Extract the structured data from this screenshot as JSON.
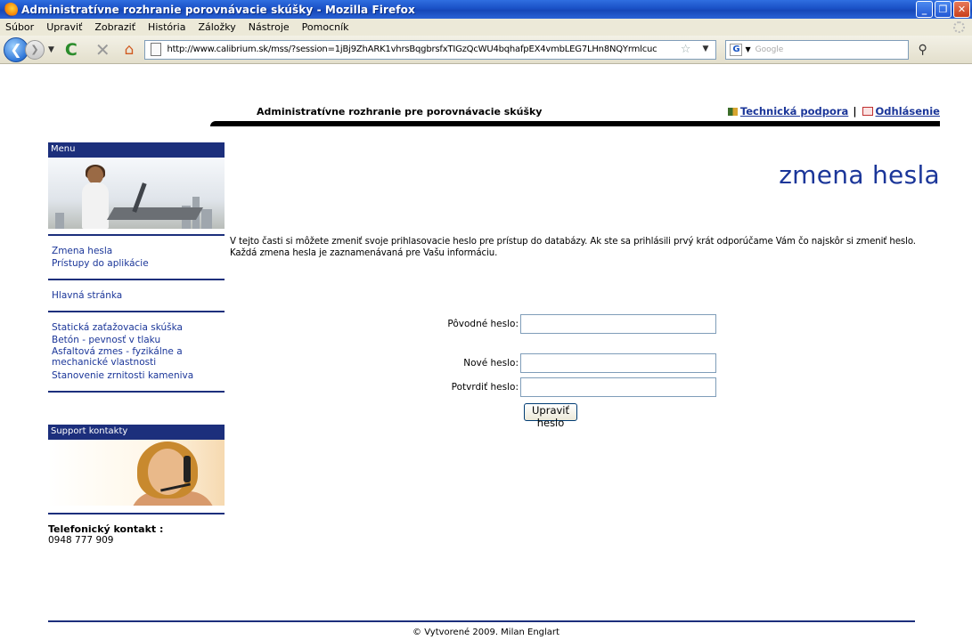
{
  "browser": {
    "window_title": "Administratívne rozhranie porovnávacie skúšky - Mozilla Firefox",
    "menu": [
      "Súbor",
      "Upraviť",
      "Zobraziť",
      "História",
      "Záložky",
      "Nástroje",
      "Pomocník"
    ],
    "url": "http://www.calibrium.sk/mss/?session=1jBj9ZhARK1vhrsBqgbrsfxTIGzQcWU4bqhafpEX4vmbLEG7LHn8NQYrmlcuc",
    "search_placeholder": "Google"
  },
  "header": {
    "title": "Administratívne rozhranie pre porovnávacie skúšky",
    "support_link": "Technická podpora",
    "separator": "|",
    "logout_link": "Odhlásenie"
  },
  "sidebar": {
    "menu_heading": "Menu",
    "groups": [
      [
        "Zmena hesla",
        "Prístupy do aplikácie"
      ],
      [
        "Hlavná stránka"
      ],
      [
        "Statická zaťažovacia skúška",
        "Betón - pevnosť v tlaku",
        "Asfaltová zmes - fyzikálne a mechanické vlastnosti",
        "Stanovenie zrnitosti kameniva"
      ]
    ],
    "support_heading": "Support kontakty",
    "phone_label": "Telefonický kontakt :",
    "phone_number": "0948 777 909"
  },
  "main": {
    "heading": "zmena hesla",
    "intro_line1": "V tejto časti si môžete zmeniť svoje prihlasovacie heslo pre prístup do databázy. Ak ste sa prihlásili prvý krát odporúčame Vám čo najskôr si zmeniť heslo.",
    "intro_line2": "Každá zmena hesla je zaznamenávaná pre Vašu informáciu.",
    "form": {
      "old_password_label": "Pôvodné heslo:",
      "old_password_value": "",
      "new_password_label": "Nové heslo:",
      "new_password_value": "",
      "confirm_password_label": "Potvrdiť heslo:",
      "confirm_password_value": "",
      "submit_label": "Upraviť heslo"
    }
  },
  "footer": {
    "text": "© Vytvorené 2009. Milan Englart"
  }
}
